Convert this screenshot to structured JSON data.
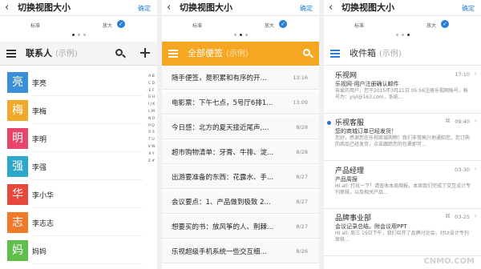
{
  "settings": {
    "back": "‹",
    "title": "切换视图大小",
    "confirm": "确定",
    "option_standard": "标准",
    "option_large": "放大",
    "check": "✓"
  },
  "contacts_panel": {
    "title": "联系人",
    "subtitle": "(示例)",
    "contacts": [
      {
        "char": "亮",
        "name": "李亮",
        "color": "#3b8fd6"
      },
      {
        "char": "梅",
        "name": "李梅",
        "color": "#f0a928"
      },
      {
        "char": "明",
        "name": "李明",
        "color": "#e8456a"
      },
      {
        "char": "强",
        "name": "李强",
        "color": "#2aa7c9"
      },
      {
        "char": "华",
        "name": "李小华",
        "color": "#e8483c"
      },
      {
        "char": "志",
        "name": "李志志",
        "color": "#f07a2a"
      },
      {
        "char": "妈",
        "name": "妈妈",
        "color": "#5fbf4a"
      }
    ],
    "alpha_index": "A B C D E F G H I J K L M N O P Q R S T U V W X Y Z #"
  },
  "notes_panel": {
    "title": "全部便签",
    "subtitle": "(示例)",
    "notes": [
      {
        "text": "随手便签，是积累和有序的开...",
        "date": "13:16"
      },
      {
        "text": "电影票：下午七点，5号厅6排1...",
        "date": "13:09"
      },
      {
        "text": "今日感：北方的夏天接近尾声,...",
        "date": "8/28"
      },
      {
        "text": "超市购物清单：牙膏、牛排、淀...",
        "date": "8/28"
      },
      {
        "text": "出游要准备的东西：花露水、手...",
        "date": "8/27"
      },
      {
        "text": "会议要点：1、产品做到极致 2...",
        "date": "8/27"
      },
      {
        "text": "想要买的书：放风筝的人、荆棘...",
        "date": "8/27"
      },
      {
        "text": "乐视超级手机系统一些交互细...",
        "date": "8/26"
      }
    ]
  },
  "mail_panel": {
    "title": "收件箱",
    "subtitle": "(示例)",
    "mails": [
      {
        "sender": "乐视网",
        "date": "17:10",
        "subject": "乐视网-用户注册确认邮件",
        "preview": "亲爱的用户，您于2015年3月21日 05:56注册乐视网账号，帐号为：yiyi@163.com，系统...",
        "unread": false,
        "clip": ""
      },
      {
        "sender": "乐视客服",
        "date": "09:40",
        "subject": "您的商城订单已经发货！",
        "preview": "您好，感谢您在乐视商城购物！我们非常高兴地通知您，您订购的商品已经发货，点击跟踪您的包裹即可...",
        "unread": true,
        "clip": "⌘"
      },
      {
        "sender": "产品经理",
        "date": "03-30",
        "subject": "产品周报",
        "preview": "HI all: 打扰一下！请查收本周周报，本周我们完成了交互设计专刊审核，以及相关产品...",
        "unread": false,
        "clip": ""
      },
      {
        "sender": "品牌事业部",
        "date": "03-25",
        "subject": "会议记录总结。附会议用PPT",
        "preview": "HI all: 周三 19日下午，我们召开了品牌讨论会，对UI设计专刊审核...",
        "unread": false,
        "clip": "⌘"
      }
    ]
  },
  "watermark": "CNMO.COM"
}
